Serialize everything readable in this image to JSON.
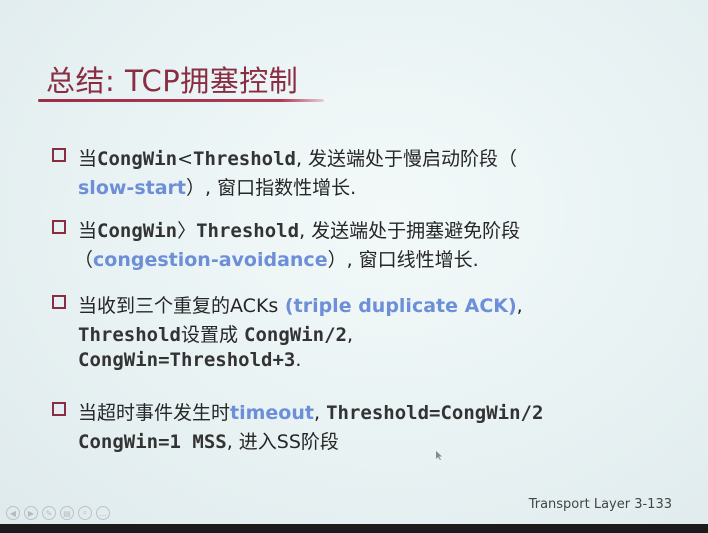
{
  "title": "总结: TCP拥塞控制",
  "bullets": [
    {
      "lines": [
        [
          {
            "t": "当",
            "s": ""
          },
          {
            "t": "CongWin",
            "s": "mono"
          },
          {
            "t": "<",
            "s": ""
          },
          {
            "t": "Threshold",
            "s": "mono"
          },
          {
            "t": ", 发送端处于慢启动阶段（",
            "s": ""
          }
        ],
        [
          {
            "t": "slow-start",
            "s": "blue"
          },
          {
            "t": "）, 窗口指数性增长.",
            "s": ""
          }
        ]
      ]
    },
    {
      "lines": [
        [
          {
            "t": "当",
            "s": ""
          },
          {
            "t": "CongWin",
            "s": "mono"
          },
          {
            "t": "〉",
            "s": ""
          },
          {
            "t": "Threshold",
            "s": "mono"
          },
          {
            "t": ", 发送端处于拥塞避免阶段",
            "s": ""
          }
        ],
        [
          {
            "t": "（",
            "s": ""
          },
          {
            "t": "congestion-avoidance",
            "s": "blue"
          },
          {
            "t": "）, 窗口线性增长.",
            "s": ""
          }
        ]
      ]
    },
    {
      "lines": [
        [
          {
            "t": "当收到三个重复的",
            "s": ""
          },
          {
            "t": "ACKs",
            "s": ""
          },
          {
            "t": " (triple duplicate ACK)",
            "s": "blue"
          },
          {
            "t": ",",
            "s": ""
          }
        ],
        [
          {
            "t": "Threshold",
            "s": "mono"
          },
          {
            "t": "设置成 ",
            "s": ""
          },
          {
            "t": "CongWin/2",
            "s": "mono"
          },
          {
            "t": ",",
            "s": ""
          }
        ],
        [
          {
            "t": "CongWin=Threshold+3",
            "s": "mono"
          },
          {
            "t": ".",
            "s": ""
          }
        ]
      ]
    },
    {
      "lines": [
        [
          {
            "t": "当超时事件发生时",
            "s": ""
          },
          {
            "t": "timeout",
            "s": "blue"
          },
          {
            "t": ", ",
            "s": ""
          },
          {
            "t": "Threshold=CongWin/2",
            "s": "mono"
          }
        ],
        [
          {
            "t": "CongWin=1 MSS",
            "s": "mono"
          },
          {
            "t": ", 进入SS阶段",
            "s": ""
          }
        ]
      ]
    }
  ],
  "footer": "Transport Layer 3-133",
  "controls": [
    "prev-icon",
    "next-icon",
    "pen-icon",
    "menu-icon",
    "zoom-icon",
    "more-icon"
  ],
  "colors": {
    "title": "#8a2d42",
    "accent_blue": "#6d8fd8",
    "background": "#eaf3f4"
  }
}
